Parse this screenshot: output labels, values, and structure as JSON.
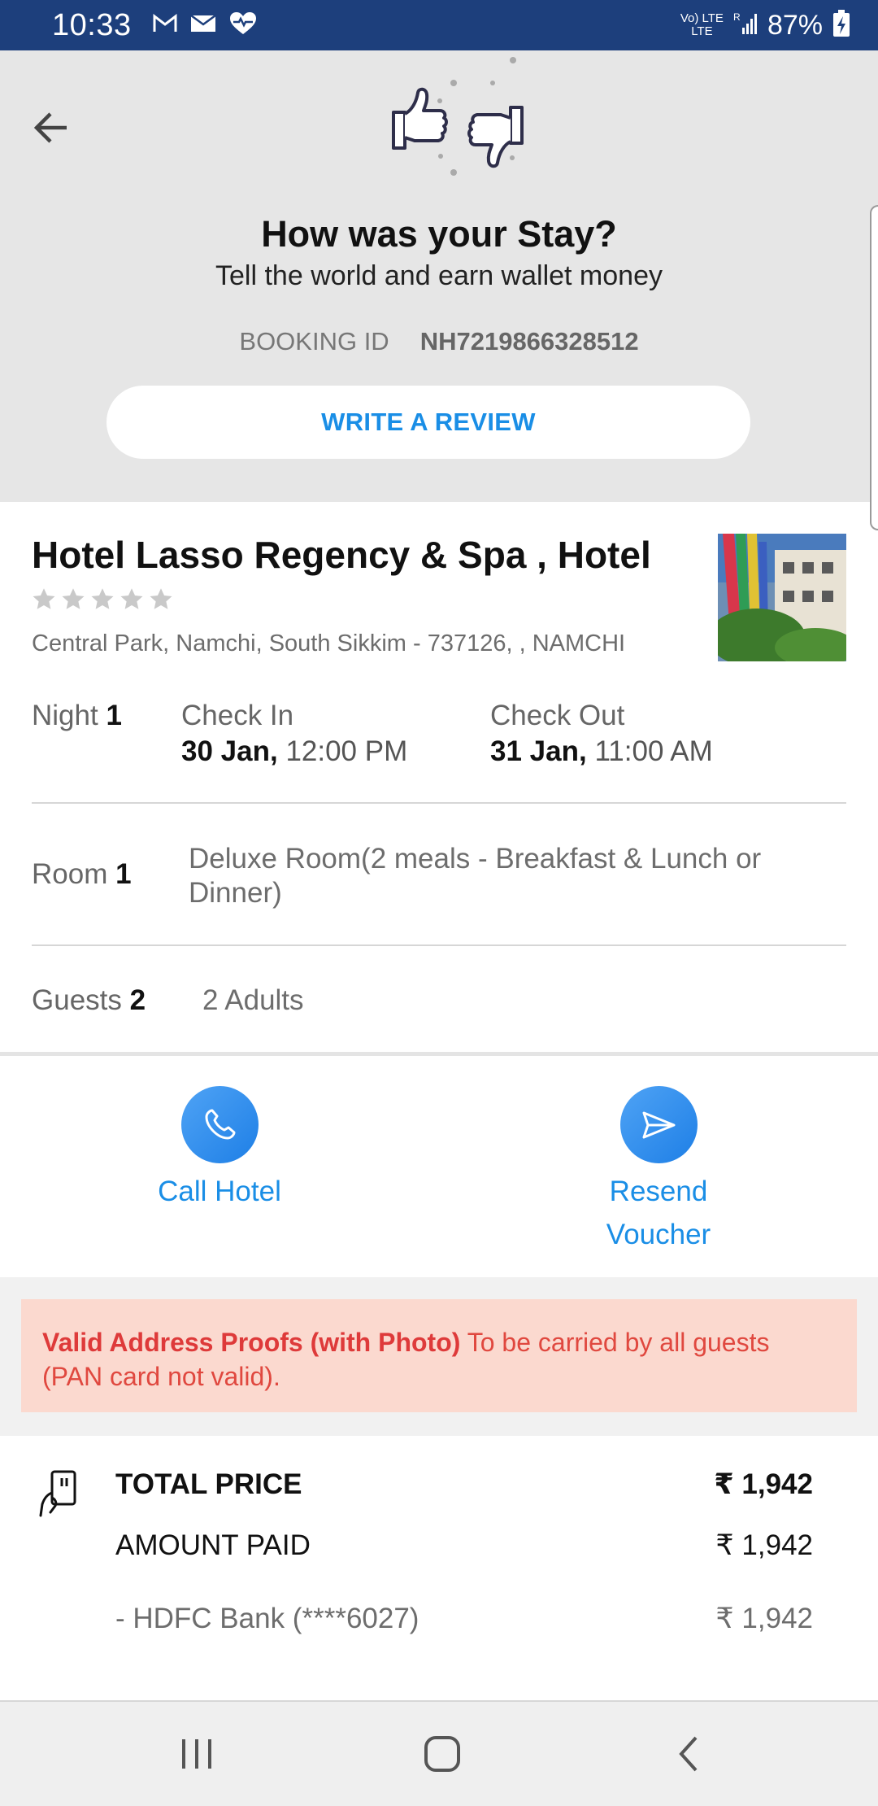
{
  "status_bar": {
    "time": "10:33",
    "network_top": "Vo) LTE",
    "network_bottom": "LTE",
    "battery": "87%"
  },
  "header": {
    "title": "How was your Stay?",
    "subtitle": "Tell the world and earn wallet money",
    "booking_label": "BOOKING ID",
    "booking_id": "NH7219866328512",
    "review_button": "WRITE A REVIEW"
  },
  "hotel": {
    "name": "Hotel Lasso Regency & Spa , Hotel",
    "star_rating": 0,
    "address": "Central Park, Namchi, South Sikkim - 737126,  , NAMCHI"
  },
  "stay": {
    "night_label": "Night",
    "night_count": "1",
    "check_in_label": "Check In",
    "check_in_date": "30 Jan,",
    "check_in_time": "12:00 PM",
    "check_out_label": "Check Out",
    "check_out_date": "31 Jan,",
    "check_out_time": "11:00 AM",
    "room_label": "Room",
    "room_count": "1",
    "room_desc": "Deluxe Room(2 meals - Breakfast & Lunch or Dinner)",
    "guests_label": "Guests",
    "guests_count": "2",
    "guests_desc": "2 Adults"
  },
  "actions": {
    "call_label": "Call Hotel",
    "resend_line1": "Resend",
    "resend_line2": "Voucher"
  },
  "alert": {
    "bold": "Valid Address Proofs (with Photo)",
    "text": " To be carried by all guests (PAN card not valid)."
  },
  "price": {
    "total_label": "TOTAL PRICE",
    "total_value": "₹ 1,942",
    "paid_label": "AMOUNT PAID",
    "paid_value": "₹ 1,942",
    "bank_label": "- HDFC Bank (****6027)",
    "bank_value": "₹ 1,942"
  },
  "colors": {
    "status_bar": "#1d3f7c",
    "accent": "#1a8ee6",
    "alert_bg": "#fbd9cf",
    "alert_text": "#e0483f"
  }
}
